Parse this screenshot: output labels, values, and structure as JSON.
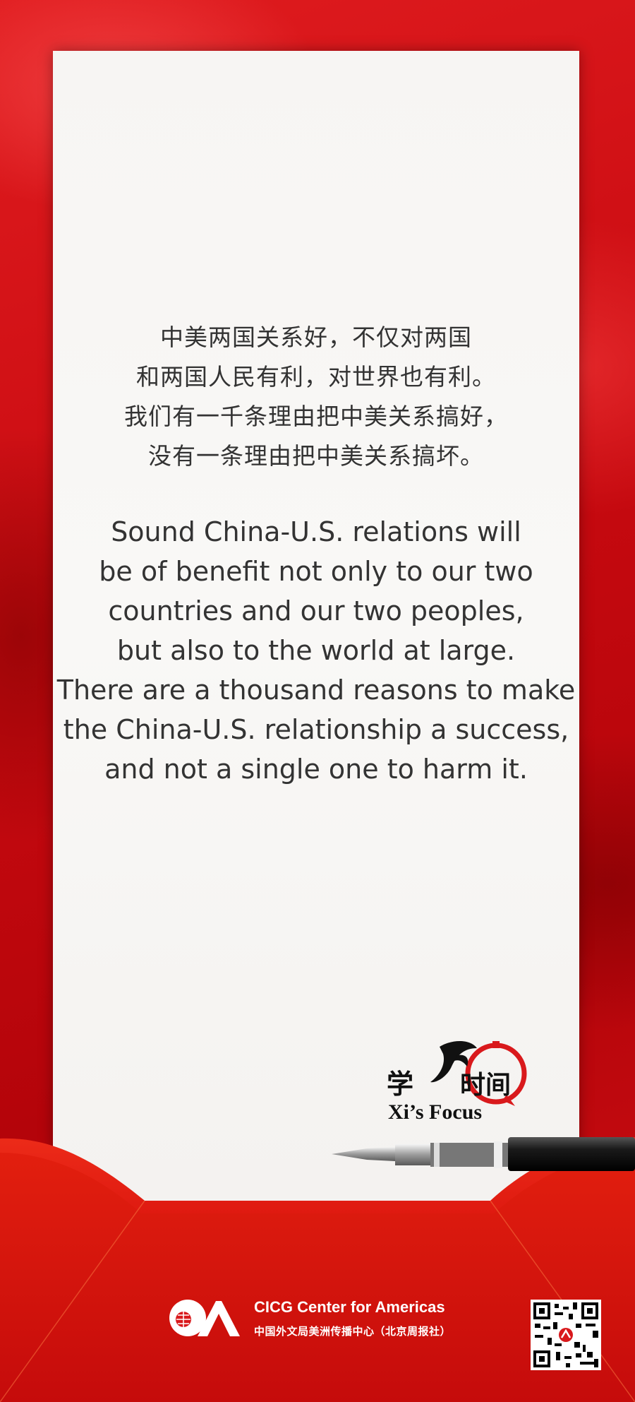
{
  "quote": {
    "zh_lines": [
      "中美两国关系好，不仅对两国",
      "和两国人民有利，对世界也有利。",
      "我们有一千条理由把中美关系搞好，",
      "没有一条理由把中美关系搞坏。"
    ],
    "en_lines": [
      "Sound China-U.S. relations will",
      "be of benefit not only to our two",
      "countries and our two peoples,",
      "but also to the world at large.",
      "There are a thousand reasons to make",
      "the China-U.S. relationship a success,",
      "and not a single one to harm it."
    ]
  },
  "brand": {
    "column_zh_1": "学",
    "column_zh_2": "习",
    "column_zh_3": "时间",
    "column_en": "Xi’s Focus"
  },
  "footer": {
    "org_en": "CICG Center for Americas",
    "org_zh": "中国外文局美洲传播中心（北京周报社）"
  },
  "colors": {
    "background_red": "#c4060d",
    "paper": "#f7f5f3",
    "text": "#333333",
    "accent_red": "#d9191c"
  }
}
